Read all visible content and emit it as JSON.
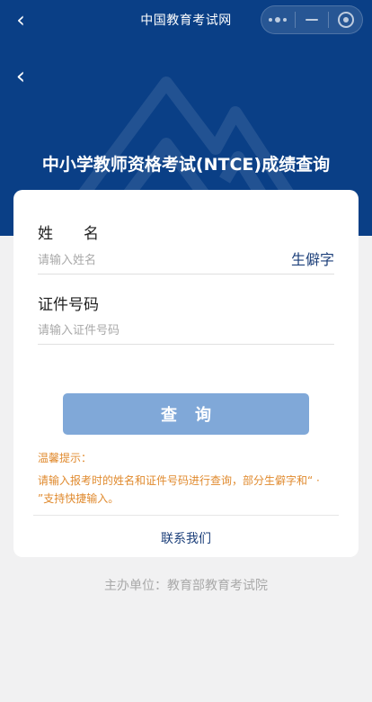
{
  "topbar": {
    "title": "中国教育考试网"
  },
  "header": {
    "title": "中小学教师资格考试(NTCE)成绩查询"
  },
  "form": {
    "name_label": "姓　　名",
    "name_placeholder": "请输入姓名",
    "rare_char_label": "生僻字",
    "id_label": "证件号码",
    "id_placeholder": "请输入证件号码",
    "query_label": "查询"
  },
  "tips": {
    "title": "温馨提示：",
    "body": "请输入报考时的姓名和证件号码进行查询，部分生僻字和“ · ”支持快捷输入。"
  },
  "contact_label": "联系我们",
  "footer": {
    "organizer": "主办单位：教育部教育考试院"
  },
  "colors": {
    "brand": "#0a3f86",
    "button": "#80a8d8",
    "tip": "#e08a2e",
    "link": "#1c3f7a"
  }
}
